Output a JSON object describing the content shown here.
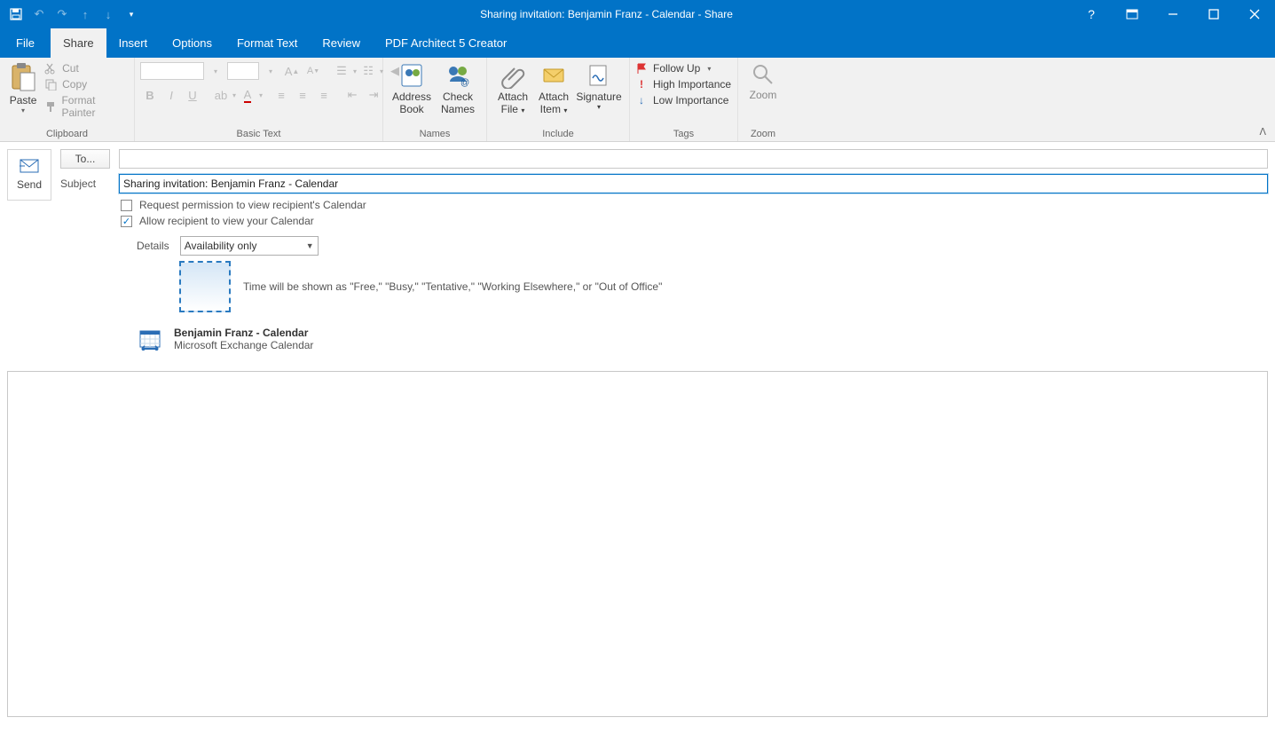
{
  "window": {
    "title": "Sharing invitation: Benjamin Franz - Calendar  -  Share"
  },
  "tabs": {
    "file": "File",
    "share": "Share",
    "insert": "Insert",
    "options": "Options",
    "format_text": "Format Text",
    "review": "Review",
    "pdf": "PDF Architect 5 Creator"
  },
  "ribbon": {
    "clipboard": {
      "paste": "Paste",
      "cut": "Cut",
      "copy": "Copy",
      "format_painter": "Format Painter",
      "group": "Clipboard"
    },
    "basic_text": {
      "group": "Basic Text"
    },
    "names": {
      "address_book_l1": "Address",
      "address_book_l2": "Book",
      "check_names_l1": "Check",
      "check_names_l2": "Names",
      "group": "Names"
    },
    "include": {
      "attach_file_l1": "Attach",
      "attach_file_l2": "File",
      "attach_item_l1": "Attach",
      "attach_item_l2": "Item",
      "signature_l1": "Signature",
      "group": "Include"
    },
    "tags": {
      "follow_up": "Follow Up",
      "high": "High Importance",
      "low": "Low Importance",
      "group": "Tags"
    },
    "zoom": {
      "label": "Zoom",
      "group": "Zoom"
    }
  },
  "form": {
    "send": "Send",
    "to_button": "To...",
    "subject_label": "Subject",
    "subject_value": "Sharing invitation: Benjamin Franz - Calendar",
    "request_permission": "Request permission to view recipient's Calendar",
    "allow_recipient": "Allow recipient to view your Calendar",
    "details_label": "Details",
    "details_value": "Availability only",
    "availability_hint": "Time will be shown as \"Free,\" \"Busy,\" \"Tentative,\" \"Working Elsewhere,\" or \"Out of Office\"",
    "calendar_name": "Benjamin Franz - Calendar",
    "calendar_type": "Microsoft Exchange Calendar"
  }
}
